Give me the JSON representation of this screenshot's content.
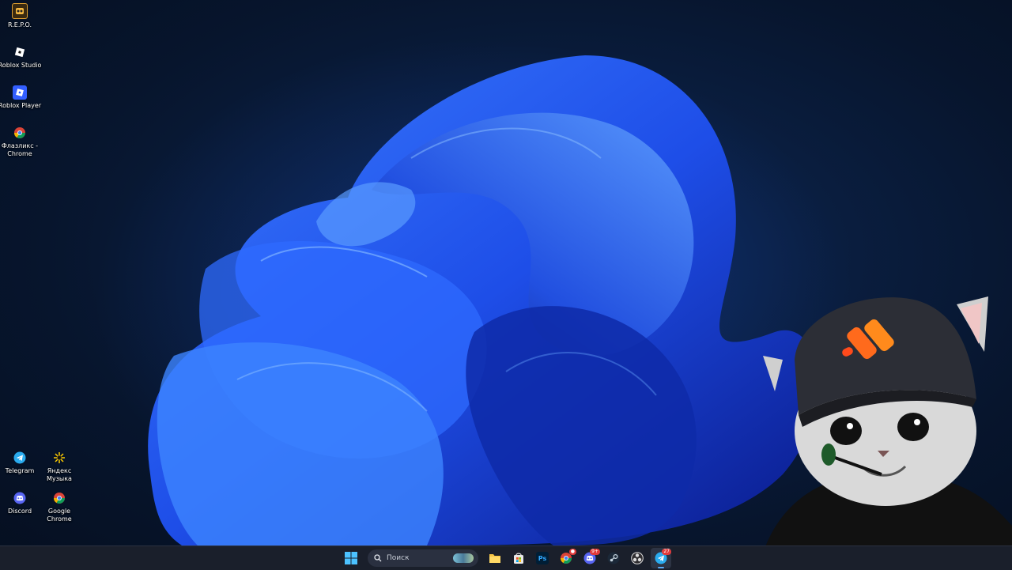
{
  "desktop": {
    "icons_left_top": [
      {
        "label": "R.E.P.O.",
        "icon": "repo-game-icon"
      },
      {
        "label": "Roblox Studio",
        "icon": "roblox-studio-icon"
      },
      {
        "label": "Roblox Player",
        "icon": "roblox-player-icon"
      },
      {
        "label": "Флазликс - Chrome",
        "icon": "chrome-icon"
      }
    ],
    "icons_bottom": [
      {
        "label": "Telegram",
        "icon": "telegram-icon"
      },
      {
        "label": "Яндекс Музыка",
        "icon": "yandex-music-icon"
      },
      {
        "label": "Discord",
        "icon": "discord-icon"
      },
      {
        "label": "Google Chrome",
        "icon": "chrome-icon"
      }
    ]
  },
  "taskbar": {
    "search_placeholder": "Поиск",
    "apps": [
      {
        "name": "start-button",
        "icon": "windows-logo-icon"
      },
      {
        "name": "file-explorer",
        "icon": "folder-icon"
      },
      {
        "name": "microsoft-store",
        "icon": "store-icon"
      },
      {
        "name": "photoshop",
        "icon": "photoshop-icon",
        "text": "Ps"
      },
      {
        "name": "chrome",
        "icon": "chrome-icon",
        "badge": "●"
      },
      {
        "name": "discord",
        "icon": "discord-icon",
        "badge": "9+"
      },
      {
        "name": "steam",
        "icon": "steam-icon"
      },
      {
        "name": "obs",
        "icon": "obs-icon"
      },
      {
        "name": "telegram",
        "icon": "telegram-icon",
        "badge": "27",
        "active": true
      }
    ]
  },
  "colors": {
    "wallpaper_bloom": "#1e4ee8",
    "taskbar_bg": "#1a1f2b",
    "accent": "#5aa9f4"
  }
}
